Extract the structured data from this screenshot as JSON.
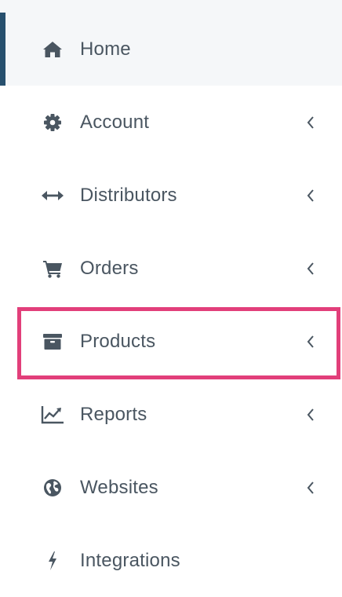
{
  "colors": {
    "text": "#4a5661",
    "active_bg": "#f5f7f9",
    "active_bar": "#27506e",
    "highlight": "#e23f7a"
  },
  "nav": {
    "items": [
      {
        "label": "Home",
        "icon": "home-icon",
        "has_chevron": false,
        "active": true
      },
      {
        "label": "Account",
        "icon": "gear-icon",
        "has_chevron": true,
        "active": false
      },
      {
        "label": "Distributors",
        "icon": "arrows-horizontal-icon",
        "has_chevron": true,
        "active": false
      },
      {
        "label": "Orders",
        "icon": "cart-icon",
        "has_chevron": true,
        "active": false
      },
      {
        "label": "Products",
        "icon": "archive-box-icon",
        "has_chevron": true,
        "active": false,
        "highlighted": true
      },
      {
        "label": "Reports",
        "icon": "line-chart-icon",
        "has_chevron": true,
        "active": false
      },
      {
        "label": "Websites",
        "icon": "globe-icon",
        "has_chevron": true,
        "active": false
      },
      {
        "label": "Integrations",
        "icon": "bolt-icon",
        "has_chevron": false,
        "active": false
      }
    ]
  }
}
